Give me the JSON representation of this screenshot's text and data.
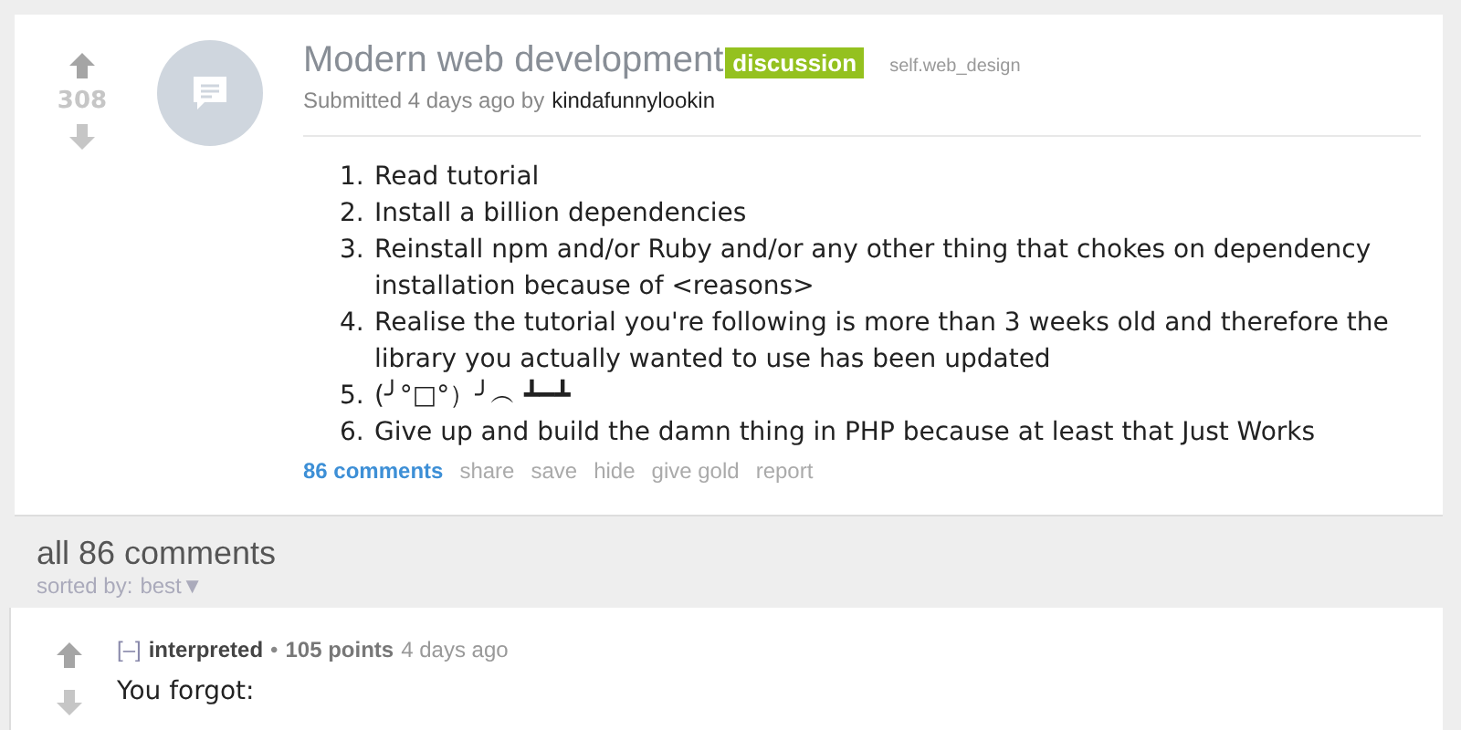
{
  "post": {
    "score": "308",
    "title": "Modern web development",
    "flair": "discussion",
    "domain": "self.web_design",
    "submitted": "Submitted 4 days ago by",
    "author": "kindafunnylookin",
    "items": [
      {
        "number": "1.",
        "text": "Read tutorial"
      },
      {
        "number": "2.",
        "text": "Install a billion dependencies"
      },
      {
        "number": "3.",
        "text": "Reinstall npm and/or Ruby and/or any other thing that chokes on dependency installation because of <reasons>"
      },
      {
        "number": "4.",
        "text": "Realise the tutorial you're following is more than 3 weeks old and therefore the library you actually wanted to use has been updated"
      },
      {
        "number": "5.",
        "text": "(╯°□°）╯︵ ┻━┻"
      },
      {
        "number": "6.",
        "text": "Give up and build the damn thing in PHP because at least that Just Works"
      }
    ],
    "actions": [
      {
        "label": "86 comments",
        "kind": "primary"
      },
      {
        "label": "share",
        "kind": "plain"
      },
      {
        "label": "save",
        "kind": "plain"
      },
      {
        "label": "hide",
        "kind": "plain"
      },
      {
        "label": "give gold",
        "kind": "plain"
      },
      {
        "label": "report",
        "kind": "plain"
      }
    ]
  },
  "comments_header": {
    "title": "all 86 comments",
    "sort_label": "sorted by:",
    "sort_value": "best▼"
  },
  "comment": {
    "collapse": "[–]",
    "author": "interpreted",
    "separator": "•",
    "points": "105 points",
    "time": "4 days ago",
    "body": "You forgot:"
  }
}
